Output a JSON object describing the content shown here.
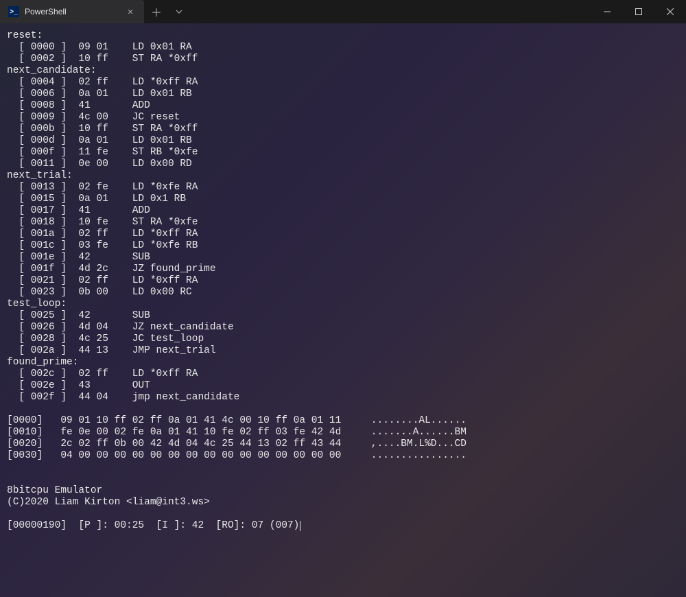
{
  "tab": {
    "title": "PowerShell",
    "icon": ">_"
  },
  "disasm": {
    "sections": [
      {
        "label": "reset:",
        "lines": [
          {
            "addr": "0000",
            "bytes": "09 01",
            "mnemonic": "LD 0x01 RA"
          },
          {
            "addr": "0002",
            "bytes": "10 ff",
            "mnemonic": "ST RA *0xff"
          }
        ]
      },
      {
        "label": "next_candidate:",
        "lines": [
          {
            "addr": "0004",
            "bytes": "02 ff",
            "mnemonic": "LD *0xff RA"
          },
          {
            "addr": "0006",
            "bytes": "0a 01",
            "mnemonic": "LD 0x01 RB"
          },
          {
            "addr": "0008",
            "bytes": "41",
            "mnemonic": "ADD"
          },
          {
            "addr": "0009",
            "bytes": "4c 00",
            "mnemonic": "JC reset"
          },
          {
            "addr": "000b",
            "bytes": "10 ff",
            "mnemonic": "ST RA *0xff"
          },
          {
            "addr": "000d",
            "bytes": "0a 01",
            "mnemonic": "LD 0x01 RB"
          },
          {
            "addr": "000f",
            "bytes": "11 fe",
            "mnemonic": "ST RB *0xfe"
          },
          {
            "addr": "0011",
            "bytes": "0e 00",
            "mnemonic": "LD 0x00 RD"
          }
        ]
      },
      {
        "label": "next_trial:",
        "lines": [
          {
            "addr": "0013",
            "bytes": "02 fe",
            "mnemonic": "LD *0xfe RA"
          },
          {
            "addr": "0015",
            "bytes": "0a 01",
            "mnemonic": "LD 0x1 RB"
          },
          {
            "addr": "0017",
            "bytes": "41",
            "mnemonic": "ADD"
          },
          {
            "addr": "0018",
            "bytes": "10 fe",
            "mnemonic": "ST RA *0xfe"
          },
          {
            "addr": "001a",
            "bytes": "02 ff",
            "mnemonic": "LD *0xff RA"
          },
          {
            "addr": "001c",
            "bytes": "03 fe",
            "mnemonic": "LD *0xfe RB"
          },
          {
            "addr": "001e",
            "bytes": "42",
            "mnemonic": "SUB"
          },
          {
            "addr": "001f",
            "bytes": "4d 2c",
            "mnemonic": "JZ found_prime"
          },
          {
            "addr": "0021",
            "bytes": "02 ff",
            "mnemonic": "LD *0xff RA"
          },
          {
            "addr": "0023",
            "bytes": "0b 00",
            "mnemonic": "LD 0x00 RC"
          }
        ]
      },
      {
        "label": "test_loop:",
        "lines": [
          {
            "addr": "0025",
            "bytes": "42",
            "mnemonic": "SUB"
          },
          {
            "addr": "0026",
            "bytes": "4d 04",
            "mnemonic": "JZ next_candidate"
          },
          {
            "addr": "0028",
            "bytes": "4c 25",
            "mnemonic": "JC test_loop"
          },
          {
            "addr": "002a",
            "bytes": "44 13",
            "mnemonic": "JMP next_trial"
          }
        ]
      },
      {
        "label": "found_prime:",
        "lines": [
          {
            "addr": "002c",
            "bytes": "02 ff",
            "mnemonic": "LD *0xff RA"
          },
          {
            "addr": "002e",
            "bytes": "43",
            "mnemonic": "OUT"
          },
          {
            "addr": "002f",
            "bytes": "44 04",
            "mnemonic": "jmp next_candidate"
          }
        ]
      }
    ]
  },
  "hexdump": [
    {
      "addr": "0000",
      "bytes": "09 01 10 ff 02 ff 0a 01 41 4c 00 10 ff 0a 01 11",
      "ascii": "........AL......"
    },
    {
      "addr": "0010",
      "bytes": "fe 0e 00 02 fe 0a 01 41 10 fe 02 ff 03 fe 42 4d",
      "ascii": ".......A......BM"
    },
    {
      "addr": "0020",
      "bytes": "2c 02 ff 0b 00 42 4d 04 4c 25 44 13 02 ff 43 44",
      "ascii": ",....BM.L%D...CD"
    },
    {
      "addr": "0030",
      "bytes": "04 00 00 00 00 00 00 00 00 00 00 00 00 00 00 00",
      "ascii": "................"
    }
  ],
  "banner": {
    "title": "8bitcpu Emulator",
    "copyright": "(C)2020 Liam Kirton <liam@int3.ws>"
  },
  "status": "[00000190]  [P ]: 00:25  [I ]: 42  [RO]: 07 (007)"
}
